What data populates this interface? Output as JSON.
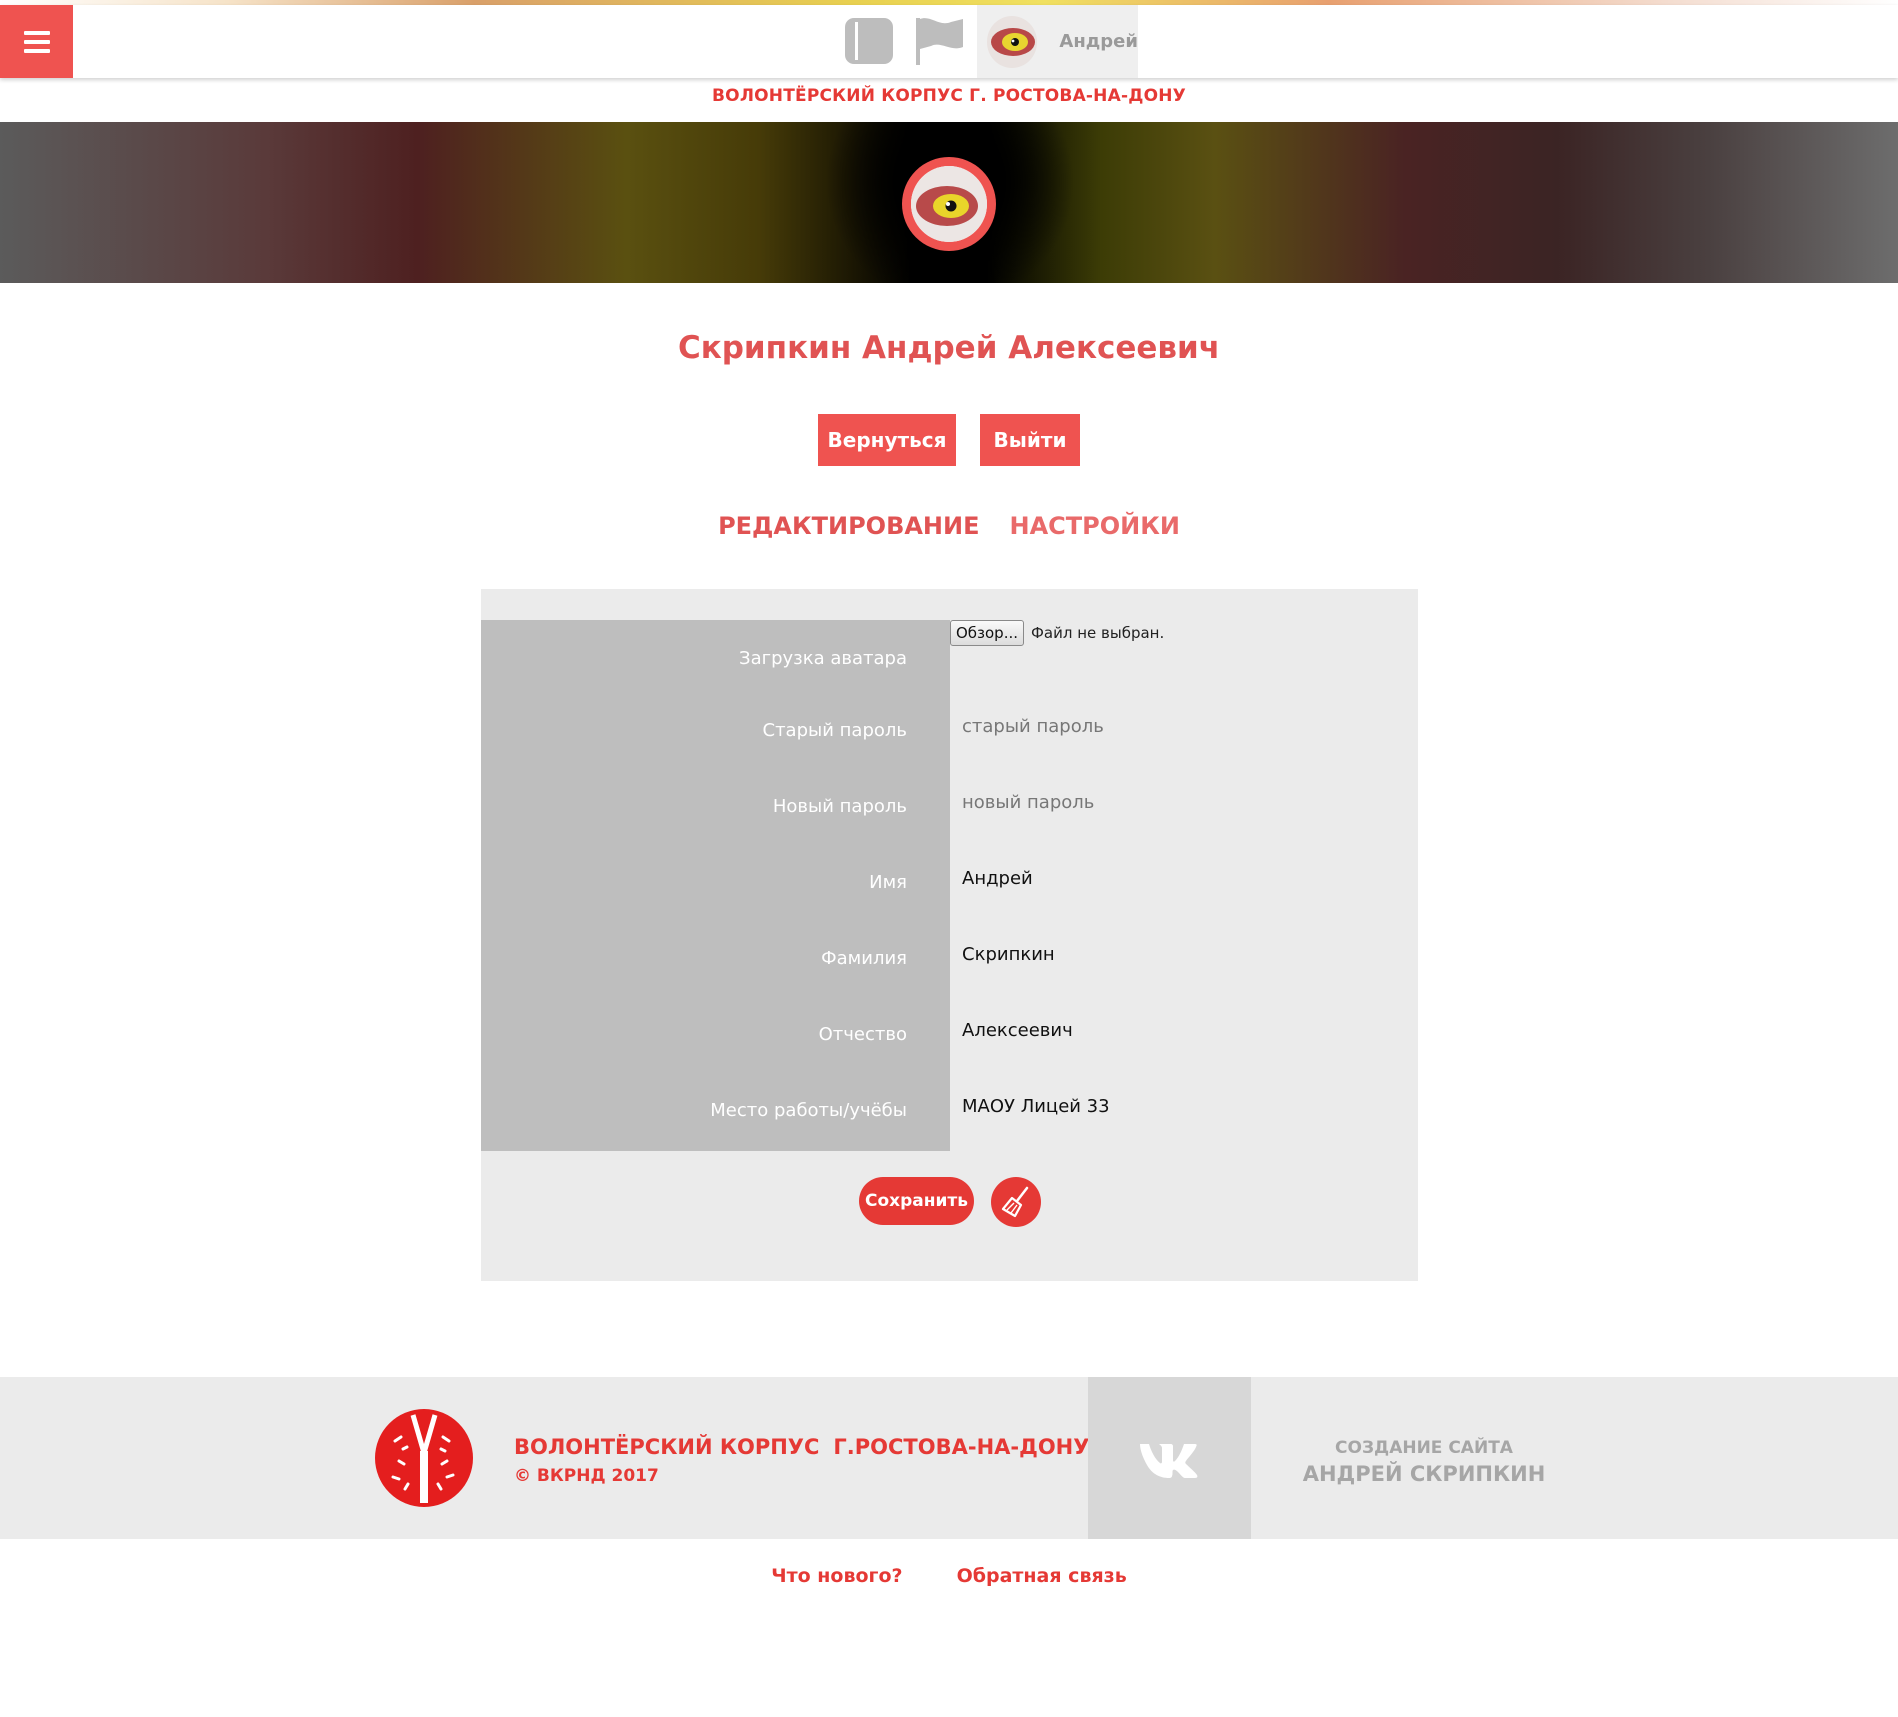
{
  "header": {
    "user_name": "Андрей",
    "icons": [
      "sidebar-panel-icon",
      "flag-icon",
      "avatar",
      "menu-icon"
    ]
  },
  "subtitle": "ВОЛОНТЁРСКИЙ КОРПУС Г. РОСТОВА-НА-ДОНУ",
  "profile": {
    "full_name": "Скрипкин Андрей Алексеевич",
    "back_label": "Вернуться",
    "exit_label": "Выйти"
  },
  "tabs": [
    {
      "label": "РЕДАКТИРОВАНИЕ"
    },
    {
      "label": "НАСТРОЙКИ"
    }
  ],
  "form": {
    "avatar_label": "Загрузка аватара",
    "file_button": "Обзор...",
    "file_status": "Файл не выбран.",
    "fields": [
      {
        "label": "Старый пароль",
        "placeholder": "старый пароль",
        "value": ""
      },
      {
        "label": "Новый пароль",
        "placeholder": "новый пароль",
        "value": ""
      },
      {
        "label": "Имя",
        "placeholder": "",
        "value": "Андрей"
      },
      {
        "label": "Фамилия",
        "placeholder": "",
        "value": "Скрипкин"
      },
      {
        "label": "Отчество",
        "placeholder": "",
        "value": "Алексеевич"
      },
      {
        "label": "Место работы/учёбы",
        "placeholder": "",
        "value": "МАОУ Лицей 33"
      }
    ],
    "save_label": "Сохранить"
  },
  "footer": {
    "title_part1": "ВОЛОНТЁРСКИЙ КОРПУС",
    "title_part2": "Г.РОСТОВА-НА-ДОНУ",
    "copyright": "© ВКРНД 2017",
    "credit_line1": "СОЗДАНИЕ САЙТА",
    "credit_line2": "АНДРЕЙ СКРИПКИН"
  },
  "bottom_links": {
    "whats_new": "Что нового?",
    "feedback": "Обратная связь"
  },
  "colors": {
    "accent": "#ef5350",
    "accent_dark": "#e53935",
    "label_bg": "#bebebe",
    "panel_bg": "#ebebeb"
  }
}
